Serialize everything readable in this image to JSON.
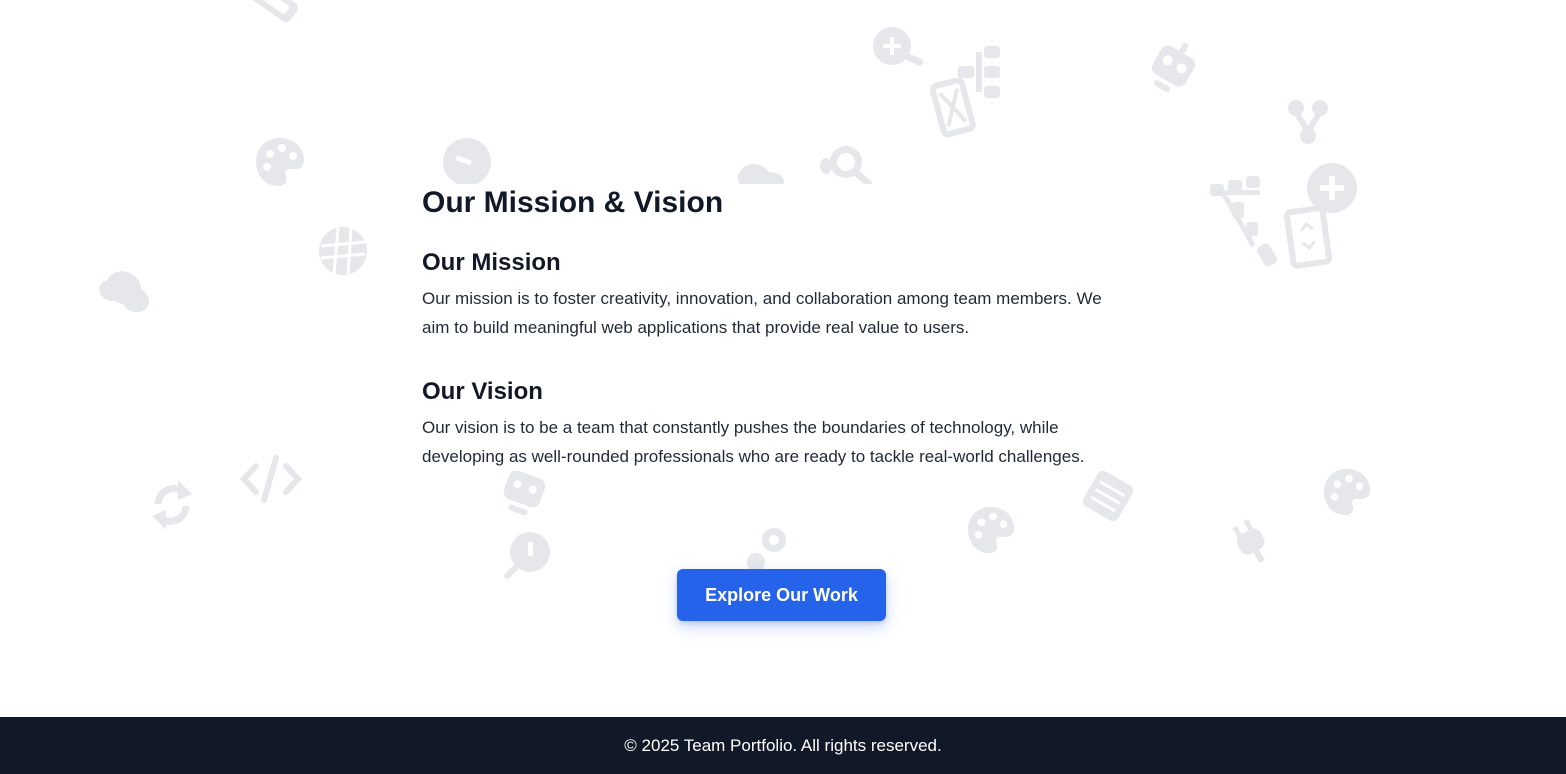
{
  "colors": {
    "background": "#ffffff",
    "text": "#111827",
    "accent": "#2563eb",
    "footer_bg": "#111827",
    "decor_icon": "#e5e7eb"
  },
  "main": {
    "title": "Our Mission & Vision",
    "mission": {
      "title": "Our Mission",
      "text": "Our mission is to foster creativity, innovation, and collaboration among team members. We aim to build meaningful web applications that provide real value to users."
    },
    "vision": {
      "title": "Our Vision",
      "text": "Our vision is to be a team that constantly pushes the boundaries of technology, while developing as well-rounded professionals who are ready to tackle real-world challenges."
    }
  },
  "cta": {
    "label": "Explore Our Work"
  },
  "footer": {
    "text": "© 2025 Team Portfolio. All rights reserved."
  },
  "background_icons": [
    "shapes-icon",
    "search-plus-icon",
    "sitemap-icon",
    "robot-icon",
    "palette-icon",
    "lightbulb-icon",
    "cloud-icon",
    "search-icon",
    "code-branch-icon",
    "plus-circle-icon",
    "globe-icon",
    "cloud-icon",
    "project-diagram-icon",
    "mobile-icon",
    "sync-icon",
    "code-icon",
    "robot-icon",
    "database-icon",
    "palette-icon",
    "gears-icon",
    "lightbulb-icon",
    "plug-icon",
    "palette-icon"
  ]
}
